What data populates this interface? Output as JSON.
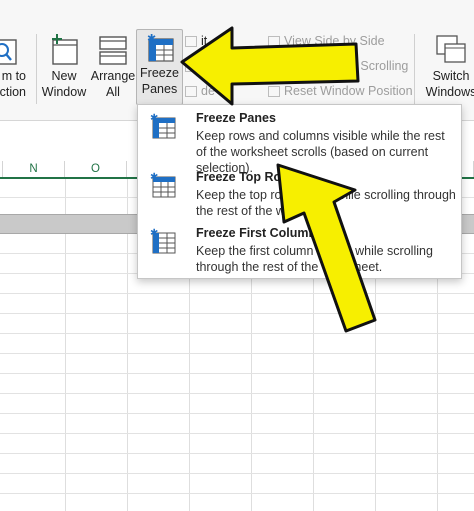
{
  "ribbon": {
    "zoom_selection_label_line1": "m to",
    "zoom_selection_label_line2": "ction",
    "new_window_line1": "New",
    "new_window_line2": "Window",
    "arrange_all_line1": "Arrange",
    "arrange_all_line2": "All",
    "freeze_panes_line1": "Freeze",
    "freeze_panes_line2": "Panes",
    "freeze_panes_caret": "⌄",
    "split_partial": "it",
    "hide_partial": "e",
    "unhide_partial": "de",
    "view_side_by_side": "View Side by Side",
    "synchronous_scrolling": "Synchronous Scrolling",
    "reset_window_position": "Reset Window Position",
    "switch_windows_line1": "Switch",
    "switch_windows_line2": "Windows"
  },
  "sheet": {
    "columns": [
      "N",
      "O"
    ]
  },
  "freeze_menu": {
    "items": [
      {
        "title": "Freeze Panes",
        "description": "Keep rows and columns visible while the rest of the worksheet scrolls (based on current selection)."
      },
      {
        "title": "Freeze Top Row",
        "description": "Keep the top row visible while scrolling through the rest of the worksheet."
      },
      {
        "title": "Freeze First Column",
        "description": "Keep the first column visible while scrolling through the rest of the worksheet."
      }
    ]
  },
  "colors": {
    "excel_green": "#217346",
    "icon_blue": "#1f6fc4",
    "arrow_fill": "#f7ef00",
    "arrow_outline": "#111111"
  }
}
